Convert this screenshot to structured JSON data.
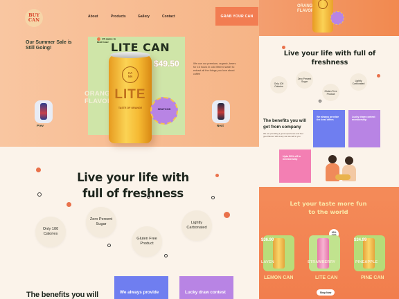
{
  "brand": {
    "logo_text": "BUY\nCAN"
  },
  "nav": {
    "about": "About",
    "products": "Products",
    "gallery": "Gallery",
    "contact": "Contact",
    "cta": "GRAB YOUR CAN"
  },
  "hero": {
    "sale": "Our Summer Sale is Still Going!",
    "hot_badge": "15 sales in last hour",
    "title": "LITE CAN",
    "price": "$49.50",
    "description": "We can our premium, organic, beers for 16 hours in cold filtered water to extract all the things you love about coffee",
    "flavor": "ORANGE\nFLAVOR",
    "can_brand": "CA\nNN",
    "can_word": "LITE",
    "can_sub": "TASTE OF ORANGE",
    "seal_text": "SEAFOOD",
    "prev_label": "Prev",
    "next_label": "Next"
  },
  "freshness": {
    "title": "Live your life with full of freshness",
    "features": [
      "Only 100 Calories",
      "Zero Percent Sugar",
      "Gluten Free Product",
      "Lightly Carbonated"
    ]
  },
  "benefits": {
    "title": "The benefits you will",
    "cards": [
      "We always provide",
      "Lucky draw contest"
    ]
  },
  "right": {
    "hero_flavor": "ORANGE\nFLAVOR",
    "title": "Live your life with full of freshness",
    "features": [
      "Only 100 Calories",
      "Zero Percent Sugar",
      "Gluten Free Product",
      "Lightly Carbonated"
    ],
    "benefits_title": "The benefits you will get from company",
    "benefits_desc": "We are providing a great experience and feel good flavour with every can we sell to you",
    "cards": [
      "We always provide the best offers",
      "Lucky draw contest membership",
      "Upto 50% off in membership"
    ],
    "taste_title": "Let your taste more fun to the world",
    "badge": "10% OFF",
    "products": [
      {
        "price": "$36.90",
        "flavor": "LAVEN",
        "name": "LEMON CAN"
      },
      {
        "price": "",
        "flavor": "STRAWBERRY",
        "name": "LITE CAN"
      },
      {
        "price": "$34.99",
        "flavor": "PINEAPPLE",
        "name": "PINE CAN"
      }
    ],
    "shop_now": "Shop Now"
  },
  "colors": {
    "accent": "#f27d52",
    "green_card": "#cfe5a8",
    "purple": "#b884e4",
    "blue": "#6f7ef0"
  }
}
